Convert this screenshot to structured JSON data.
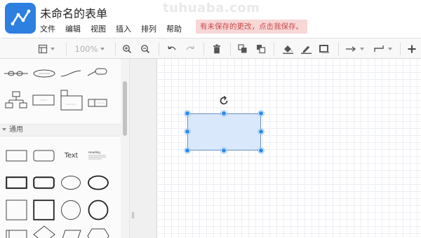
{
  "window": {
    "title": "未命名的表单",
    "watermark": "tuhuaba.com",
    "unsaved_notice": "有未保存的更改，点击我保存。"
  },
  "menu": {
    "items": [
      "文件",
      "编辑",
      "视图",
      "插入",
      "排列",
      "帮助"
    ]
  },
  "toolbar": {
    "zoom": "100%",
    "icons": [
      "page-view-icon",
      "zoom-in-icon",
      "zoom-out-icon",
      "undo-icon",
      "redo-icon",
      "delete-icon",
      "to-front-icon",
      "to-back-icon",
      "fill-color-icon",
      "line-color-icon",
      "shadow-icon",
      "connection-arrow-icon",
      "waypoint-icon",
      "insert-plus-icon"
    ]
  },
  "sidebar": {
    "section_general": "通用",
    "text_shape_label": "Text",
    "heading_shape_label": "Heading"
  },
  "colors": {
    "accent": "#2d7fe0",
    "selection_fill": "#dae8fc",
    "selection_stroke": "#6c8ebf",
    "handle": "#2b8bea",
    "notice_bg": "#f8d7d7",
    "notice_text": "#c94a4a"
  }
}
